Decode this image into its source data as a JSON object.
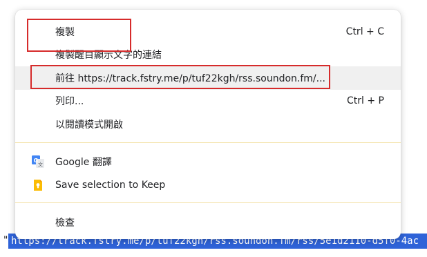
{
  "page": {
    "quote_char": "\"",
    "selected_text": "https://track.fstry.me/p/tuf22kgh/rss.soundon.fm/rss/5e1d2110-d5f0-4ac"
  },
  "menu": {
    "items": [
      {
        "label": "複製",
        "shortcut": "Ctrl + C"
      },
      {
        "label": "複製醒目顯示文字的連結",
        "shortcut": ""
      },
      {
        "label": "前往 https://track.fstry.me/p/tuf22kgh/rss.soundon.fm/...",
        "shortcut": ""
      },
      {
        "label": "列印...",
        "shortcut": "Ctrl + P"
      },
      {
        "label": "以閱讀模式開啟",
        "shortcut": ""
      },
      {
        "label": "Google 翻譯",
        "shortcut": "",
        "icon": "google-translate-icon"
      },
      {
        "label": "Save selection to Keep",
        "shortcut": "",
        "icon": "google-keep-icon"
      },
      {
        "label": "檢查",
        "shortcut": ""
      }
    ]
  },
  "colors": {
    "annotation": "#d62b2b",
    "selection": "#2f63d8",
    "hover": "#f0f0f0",
    "separator": "#f3e2a8"
  }
}
